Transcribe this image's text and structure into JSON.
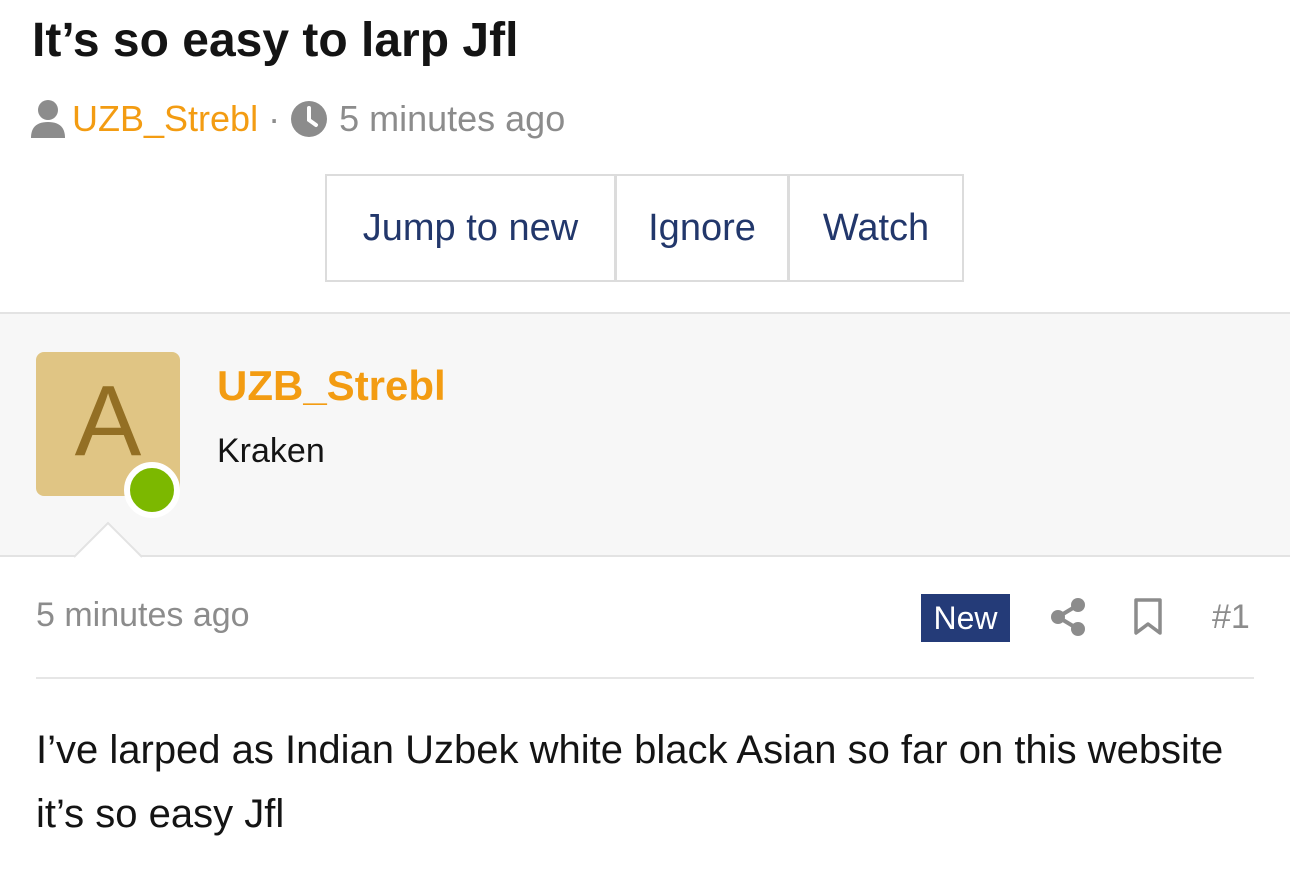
{
  "thread": {
    "title": "It’s so easy to larp Jfl",
    "author": "UZB_Strebl",
    "separator": "·",
    "time": "5 minutes ago"
  },
  "actions": {
    "jump_label": "Jump to new",
    "ignore_label": "Ignore",
    "watch_label": "Watch"
  },
  "post": {
    "avatar_letter": "A",
    "author": "UZB_Strebl",
    "user_title": "Kraken",
    "time": "5 minutes ago",
    "badge": "New",
    "number": "#1",
    "body": "I’ve larped as Indian Uzbek white black Asian so far on this website it’s so easy Jfl"
  },
  "colors": {
    "accent_orange": "#f39c12",
    "link_navy": "#22376b",
    "badge_navy": "#243b78",
    "online_green": "#7cb800",
    "avatar_bg": "#e0c584",
    "avatar_letter": "#936f24",
    "muted_gray": "#8c8c8c"
  },
  "icons": {
    "author": "user-icon",
    "time": "clock-icon",
    "share": "share-icon",
    "bookmark": "bookmark-icon"
  }
}
